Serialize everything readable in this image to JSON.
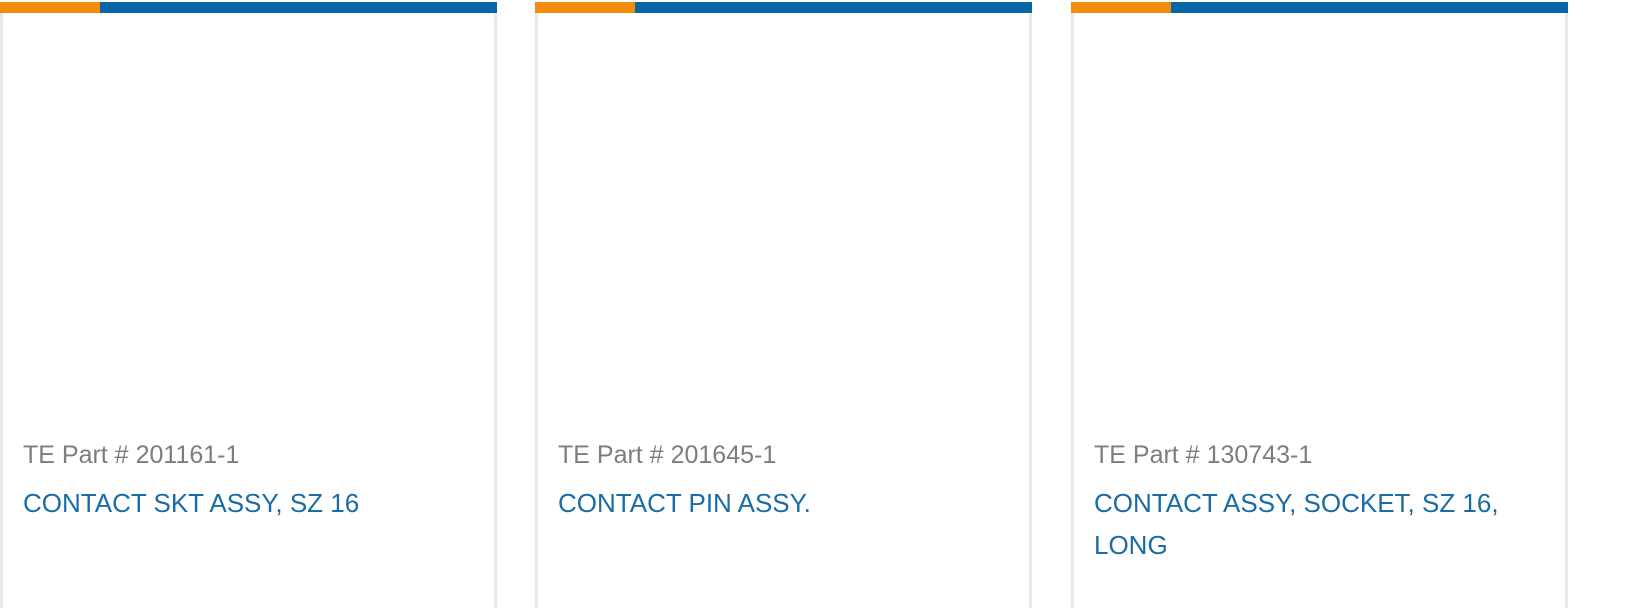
{
  "colors": {
    "accent_orange": "#f28c0a",
    "accent_blue": "#0767a6",
    "part_number_text": "#7d7d7d",
    "title_link": "#1a6ca6",
    "card_border": "#e8e8e8"
  },
  "products": [
    {
      "part_prefix": "TE Part #",
      "part_number": "201161-1",
      "title": "CONTACT SKT ASSY, SZ 16"
    },
    {
      "part_prefix": "TE Part #",
      "part_number": "201645-1",
      "title": "CONTACT PIN ASSY."
    },
    {
      "part_prefix": "TE Part #",
      "part_number": "130743-1",
      "title": "CONTACT ASSY, SOCKET, SZ 16, LONG"
    }
  ]
}
